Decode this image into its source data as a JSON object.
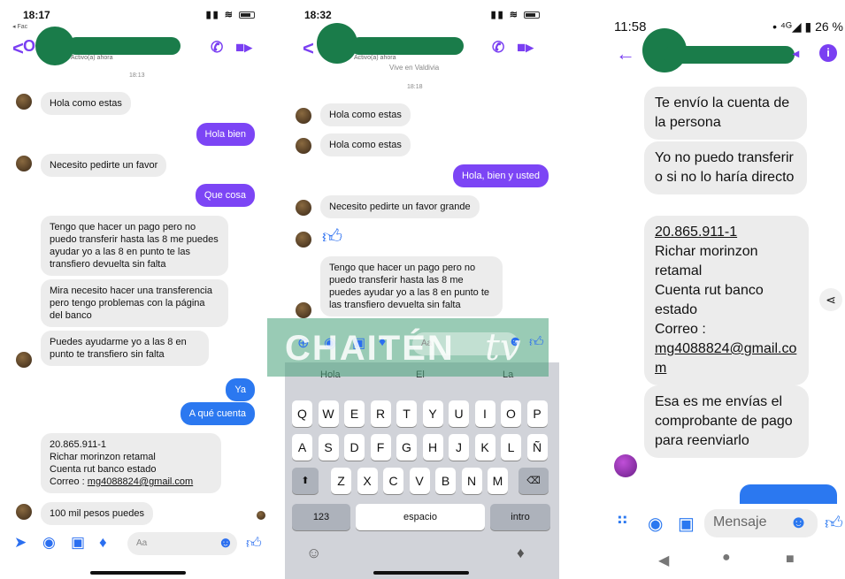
{
  "p1": {
    "time": "18:17",
    "status_sub": "◂ Fac",
    "active": "Activo(a) ahora",
    "timestamp": "18:13",
    "msgs": [
      "Hola como estas",
      "Hola bien",
      "Necesito pedirte un favor",
      "Que cosa",
      "Tengo que hacer un pago pero no puedo transferir hasta las 8 me puedes ayudar yo a las 8 en punto te las transfiero devuelta sin falta",
      "Mira necesito hacer una transferencia pero tengo problemas con la página del banco",
      "Puedes ayudarme yo a las 8 en punto te transfiero sin falta",
      "Ya",
      "A qué cuenta",
      "100 mil pesos puedes"
    ],
    "account": {
      "line1": "20.865.911-1",
      "line2": "Richar morinzon retamal",
      "line3": "Cuenta rut banco estado",
      "line4_prefix": "Correo : ",
      "email": "mg4088824@gmail.com"
    },
    "input_placeholder": "Aa"
  },
  "p2": {
    "time": "18:32",
    "active": "Activo(a) ahora",
    "location": "Vive en Valdivia",
    "timestamp": "18:18",
    "msgs": [
      "Hola como estas",
      "Hola como estas",
      "Hola, bien y usted",
      "Necesito pedirte un favor grande",
      "Tengo que hacer un pago pero no puedo transferir hasta las 8 me puedes ayudar yo a las 8 en punto te las transfiero devuelta sin falta"
    ],
    "suggestions": [
      "Hola",
      "El",
      "La"
    ],
    "input_placeholder": "Aa",
    "rows": [
      [
        "Q",
        "W",
        "E",
        "R",
        "T",
        "Y",
        "U",
        "I",
        "O",
        "P"
      ],
      [
        "A",
        "S",
        "D",
        "F",
        "G",
        "H",
        "J",
        "K",
        "L",
        "Ñ"
      ],
      [
        "Z",
        "X",
        "C",
        "V",
        "B",
        "N",
        "M"
      ]
    ],
    "key_123": "123",
    "key_space": "espacio",
    "key_return": "intro"
  },
  "watermark": {
    "brand": "CHAITÉN",
    "tv": "tv"
  },
  "p3": {
    "time": "11:58",
    "status_right": "• ⁴ᴳ◢ ▮ 26 %",
    "msgs": [
      "Te envío la cuenta de la persona",
      "Yo no puedo transferir o si no lo haría directo",
      "Esa es me envías el comprobante de pago para reenviarlo"
    ],
    "account": {
      "line1": "20.865.911-1",
      "line2": "Richar morinzon retamal",
      "line3": "Cuenta rut banco estado",
      "line4": "Correo :",
      "email": "mg4088824@gmail.com"
    },
    "input_placeholder": "Mensaje"
  },
  "colors": {
    "purple": "#7c45f5",
    "blue": "#2b78f0",
    "redaction": "#1a7c4a"
  }
}
